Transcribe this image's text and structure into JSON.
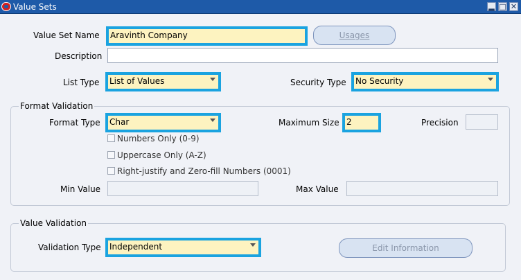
{
  "window": {
    "title": "Value Sets",
    "controls": {
      "minimize": "▂",
      "maximize": "□",
      "close": "✕"
    }
  },
  "form": {
    "value_set_name_label": "Value Set Name",
    "value_set_name_value": "Aravinth Company",
    "usages_button": "Usages",
    "description_label": "Description",
    "description_value": "",
    "list_type_label": "List Type",
    "list_type_value": "List of Values",
    "security_type_label": "Security Type",
    "security_type_value": "No Security"
  },
  "format_validation": {
    "group_title": "Format Validation",
    "format_type_label": "Format Type",
    "format_type_value": "Char",
    "maximum_size_label": "Maximum Size",
    "maximum_size_value": "2",
    "precision_label": "Precision",
    "precision_value": "",
    "numbers_only_label": "Numbers Only (0-9)",
    "numbers_only_checked": false,
    "uppercase_only_label": "Uppercase Only (A-Z)",
    "uppercase_only_checked": false,
    "right_justify_label": "Right-justify and Zero-fill Numbers (0001)",
    "right_justify_checked": false,
    "min_value_label": "Min Value",
    "min_value_value": "",
    "max_value_label": "Max Value",
    "max_value_value": ""
  },
  "value_validation": {
    "group_title": "Value Validation",
    "validation_type_label": "Validation Type",
    "validation_type_value": "Independent",
    "edit_information_button": "Edit Information"
  }
}
